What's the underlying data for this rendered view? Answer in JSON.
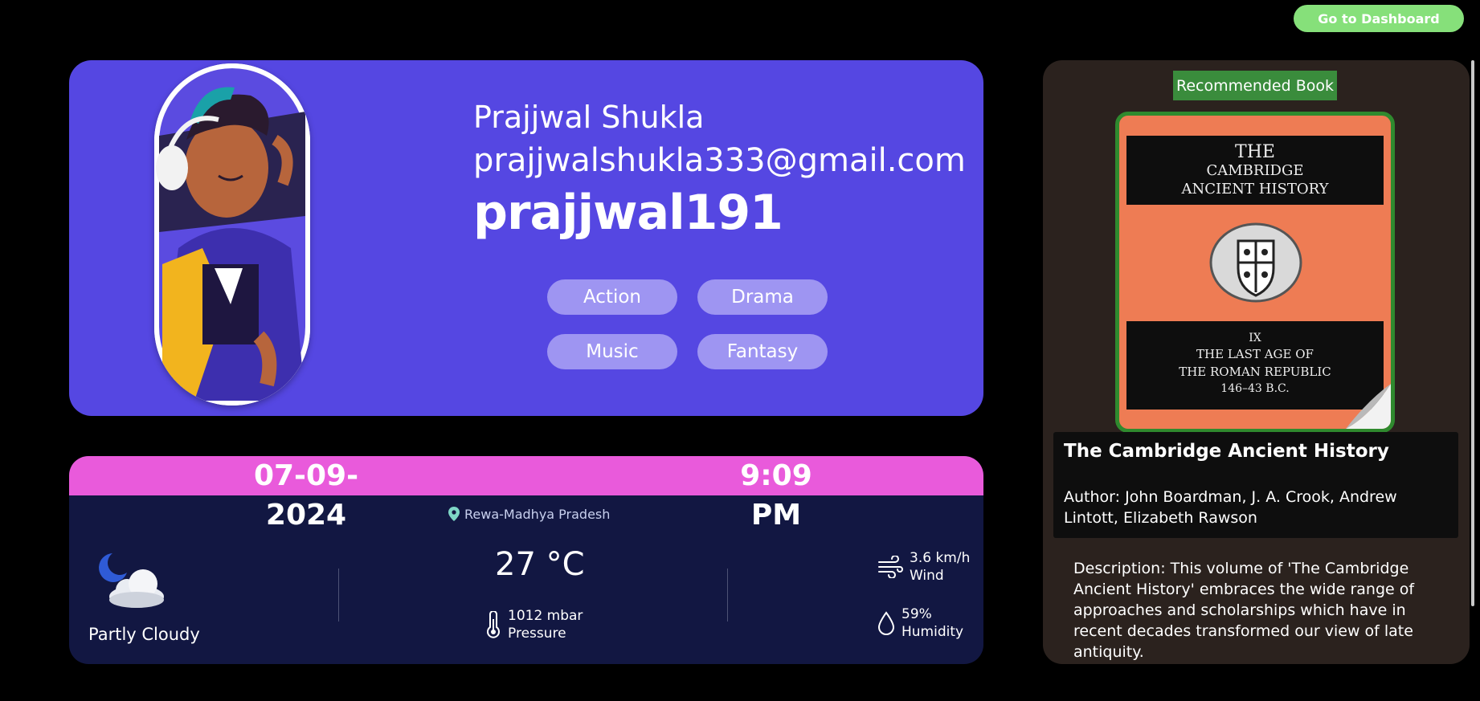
{
  "header": {
    "dashboard_button": "Go to Dashboard"
  },
  "profile": {
    "name": "Prajjwal Shukla",
    "email": "prajjwalshukla333@gmail.com",
    "username": "prajjwal191",
    "genres": [
      "Action",
      "Drama",
      "Music",
      "Fantasy"
    ],
    "avatar_icon": "avatar-illustration"
  },
  "weather": {
    "date": "07-09-2024",
    "time": "9:09 PM",
    "location": "Rewa-Madhya Pradesh",
    "condition": "Partly Cloudy",
    "temperature": "27 °C",
    "pressure_value": "1012 mbar",
    "pressure_label": "Pressure",
    "wind_value": "3.6 km/h",
    "wind_label": "Wind",
    "humidity_value": "59%",
    "humidity_label": "Humidity"
  },
  "book": {
    "badge": "Recommended Book",
    "cover": {
      "top_lines": [
        "THE",
        "CAMBRIDGE",
        "ANCIENT HISTORY"
      ],
      "volume": "IX",
      "bottom_lines": [
        "THE LAST AGE OF",
        "THE ROMAN REPUBLIC",
        "146–43 B.C."
      ]
    },
    "title": "The Cambridge Ancient History",
    "author": "Author: John Boardman, J. A. Crook, Andrew Lintott, Elizabeth Rawson",
    "description": "Description: This volume of 'The Cambridge Ancient History' embraces the wide range of approaches and scholarships which have in recent decades transformed our view of late antiquity."
  },
  "colors": {
    "profile_bg": "#5547e2",
    "chip_bg": "#9e95f2",
    "weather_header": "#e95adb",
    "weather_bg": "#121742",
    "dashboard_btn": "#86e07a",
    "book_badge": "#3a8c3c",
    "book_cover": "#ee7c54"
  }
}
